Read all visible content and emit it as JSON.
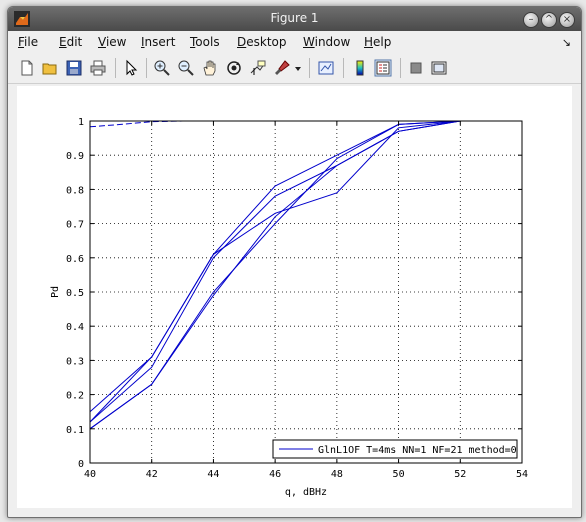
{
  "window": {
    "title": "Figure 1"
  },
  "menu": [
    {
      "label": "File",
      "key": "F",
      "rest": "ile"
    },
    {
      "label": "Edit",
      "key": "E",
      "rest": "dit"
    },
    {
      "label": "View",
      "key": "V",
      "rest": "iew"
    },
    {
      "label": "Insert",
      "key": "I",
      "rest": "nsert"
    },
    {
      "label": "Tools",
      "key": "T",
      "rest": "ools"
    },
    {
      "label": "Desktop",
      "key": "D",
      "rest": "esktop"
    },
    {
      "label": "Window",
      "key": "W",
      "rest": "indow"
    },
    {
      "label": "Help",
      "key": "H",
      "rest": "elp"
    }
  ],
  "toolbar_icons": [
    "new-figure-icon",
    "open-file-icon",
    "save-icon",
    "print-icon",
    "pointer-arrow-icon",
    "zoom-in-icon",
    "zoom-out-icon",
    "pan-hand-icon",
    "rotate-3d-icon",
    "data-cursor-icon",
    "brush-icon",
    "brush-dropdown-icon",
    "link-plot-icon",
    "colorbar-icon",
    "legend-icon",
    "hide-plot-tools-icon",
    "show-plot-tools-icon"
  ],
  "colors": {
    "line": "#0000cc",
    "grid": "#000000"
  },
  "chart_data": {
    "type": "line",
    "xlabel": "q, dBHz",
    "ylabel": "Pd",
    "xlim": [
      40,
      54
    ],
    "ylim": [
      0,
      1
    ],
    "xticks": [
      "40",
      "42",
      "44",
      "46",
      "48",
      "50",
      "52",
      "54"
    ],
    "yticks": [
      "0",
      "0.1",
      "0.2",
      "0.3",
      "0.4",
      "0.5",
      "0.6",
      "0.7",
      "0.8",
      "0.9",
      "1"
    ],
    "grid": true,
    "legend_location": "bottom-right",
    "series": [
      {
        "name": "GlnL1OF T=4ms NN=1 NF=21 method=0",
        "x": [
          40,
          42,
          44,
          46,
          48,
          50,
          52
        ],
        "y": [
          0.15,
          0.31,
          0.61,
          0.81,
          0.9,
          0.99,
          1.0
        ]
      },
      {
        "name": "",
        "x": [
          40,
          42,
          44,
          46,
          48,
          50,
          52
        ],
        "y": [
          0.12,
          0.31,
          0.61,
          0.73,
          0.79,
          0.98,
          1.0
        ]
      },
      {
        "name": "",
        "x": [
          40,
          42,
          44,
          46,
          48,
          50,
          52
        ],
        "y": [
          0.1,
          0.23,
          0.5,
          0.7,
          0.89,
          0.99,
          1.0
        ]
      },
      {
        "name": "",
        "x": [
          40,
          42,
          44,
          46,
          48,
          50,
          52
        ],
        "y": [
          0.12,
          0.28,
          0.6,
          0.78,
          0.87,
          0.97,
          1.0
        ]
      },
      {
        "name": "",
        "x": [
          40,
          42,
          44,
          46,
          48,
          50,
          52
        ],
        "y": [
          0.1,
          0.23,
          0.49,
          0.72,
          0.87,
          0.97,
          1.0
        ]
      }
    ],
    "top_dashed": {
      "x": [
        40,
        41,
        42,
        43,
        44,
        46,
        48,
        50,
        52,
        54
      ],
      "y": [
        0.983,
        0.99,
        0.998,
        1.0,
        1.0,
        1.0,
        1.0,
        1.0,
        1.0,
        1.0
      ]
    }
  }
}
